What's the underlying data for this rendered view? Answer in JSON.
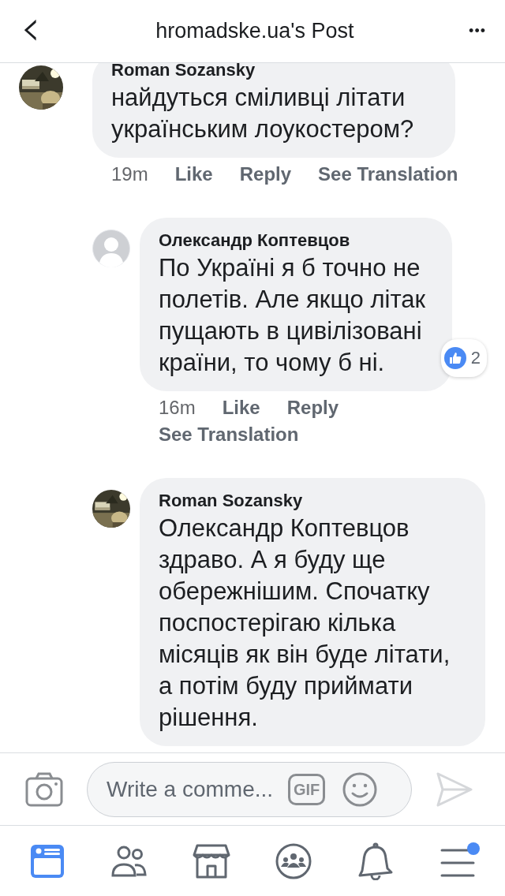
{
  "header": {
    "back": "‹",
    "title": "hromadske.ua's Post",
    "more": "•••"
  },
  "comments": [
    {
      "author": "Roman Sozansky",
      "avatar": {
        "kind": "picture"
      },
      "text": "найдуться сміливці літати українським лоукостером?",
      "time": "19m",
      "actions": [
        "Like",
        "Reply",
        "See Translation"
      ],
      "children": [
        {
          "author": "Олександр Коптевцов",
          "avatar": {
            "kind": "silhouette"
          },
          "text": "По Україні я б точно не полетів. Але якщо літак пущають в цивілізовані країни, то чому б ні.",
          "time": "16m",
          "actions": [
            "Like",
            "Reply",
            "See Translation"
          ],
          "reactions": "2"
        },
        {
          "author": "Roman Sozansky",
          "avatar": {
            "kind": "picture"
          },
          "text": "Олександр Коптевцов здраво. А я буду ще обережнішим. Спочатку поспостерігаю кілька місяців як він буде літати, а потім буду приймати рішення."
        }
      ]
    }
  ],
  "composer": {
    "placeholder": "Write a comme...",
    "gif": "GIF",
    "send_disabled": true
  },
  "tabs": [
    {
      "kind": "feed",
      "selected": true,
      "dot": false
    },
    {
      "kind": "friends",
      "selected": false,
      "dot": false
    },
    {
      "kind": "marketplace",
      "selected": false,
      "dot": false
    },
    {
      "kind": "groups",
      "selected": false,
      "dot": false
    },
    {
      "kind": "notifications",
      "selected": false,
      "dot": false
    },
    {
      "kind": "menu",
      "selected": false,
      "dot": true
    }
  ]
}
